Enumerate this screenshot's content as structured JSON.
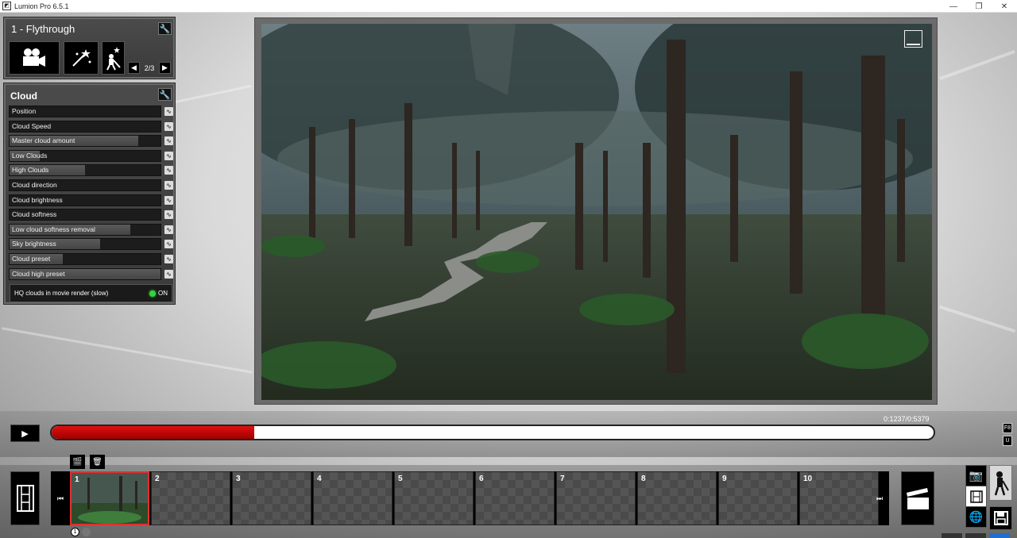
{
  "window": {
    "title": "Lumion Pro 6.5.1",
    "controls": [
      "minimize",
      "restore",
      "close"
    ]
  },
  "camera_panel": {
    "title": "1 - Flythrough",
    "pager": "2/3",
    "buttons": [
      "movie-camera-icon",
      "effects-icon",
      "weather-effects-icon"
    ]
  },
  "cloud_panel": {
    "title": "Cloud",
    "sliders": [
      {
        "label": "Position",
        "value": 0.0
      },
      {
        "label": "Cloud Speed",
        "value": 0.0
      },
      {
        "label": "Master cloud amount",
        "value": 0.85
      },
      {
        "label": "Low Clouds",
        "value": 0.2
      },
      {
        "label": "High Clouds",
        "value": 0.5
      },
      {
        "label": "Cloud direction",
        "value": 0.0
      },
      {
        "label": "Cloud brightness",
        "value": 0.0
      },
      {
        "label": "Cloud softness",
        "value": 0.0
      },
      {
        "label": "Low cloud softness removal",
        "value": 0.8
      },
      {
        "label": "Sky brightness",
        "value": 0.6
      },
      {
        "label": "Cloud preset",
        "value": 0.35
      },
      {
        "label": "Cloud high preset",
        "value": 1.0
      }
    ],
    "toggle": {
      "label": "HQ clouds in movie render (slow)",
      "state": "ON"
    }
  },
  "timeline": {
    "time": "0:1237/0:5379",
    "progress": 0.23,
    "side_tags": [
      "F8",
      "U"
    ]
  },
  "clips": [
    "1",
    "2",
    "3",
    "4",
    "5",
    "6",
    "7",
    "8",
    "9",
    "10"
  ],
  "clip_page": "1",
  "colors": {
    "progress_fill": "#d00000",
    "active_clip_border": "#e03030",
    "toggle_on": "#2fd83a"
  }
}
